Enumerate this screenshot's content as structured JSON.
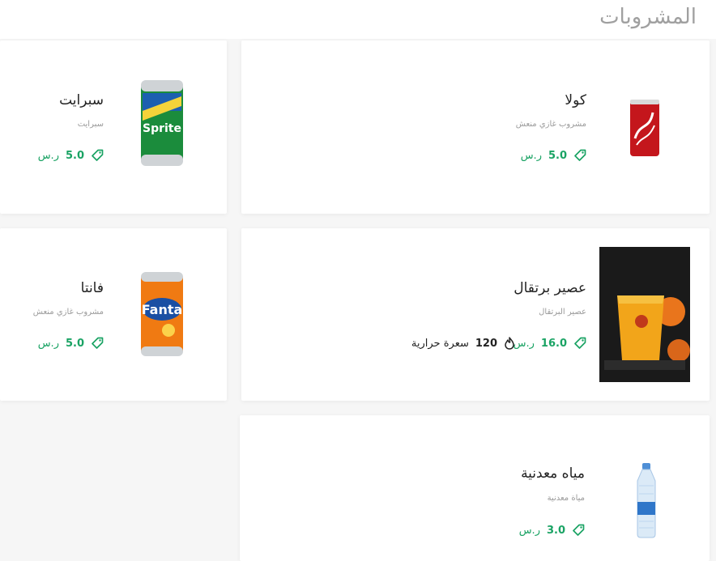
{
  "section": {
    "title": "المشروبات"
  },
  "currency": "ر.س",
  "colors": {
    "accent": "#1aa364",
    "title_gray": "#a0a0a0"
  },
  "items": [
    {
      "name": "كولا",
      "description": "مشروب غازي منعش",
      "price": "5.0",
      "image": "cola-can"
    },
    {
      "name": "سبرايت",
      "description": "سبرايت",
      "price": "5.0",
      "image": "sprite-can"
    },
    {
      "name": "عصير برتقال",
      "description": "عصير البرتقال",
      "price": "16.0",
      "calories": "120",
      "calories_label": "سعرة حرارية",
      "image": "orange-juice"
    },
    {
      "name": "فانتا",
      "description": "مشروب غازي منعش",
      "price": "5.0",
      "image": "fanta-can"
    },
    {
      "name": "مياه معدنية",
      "description": "مياة معدنية",
      "price": "3.0",
      "image": "water-bottle"
    }
  ]
}
